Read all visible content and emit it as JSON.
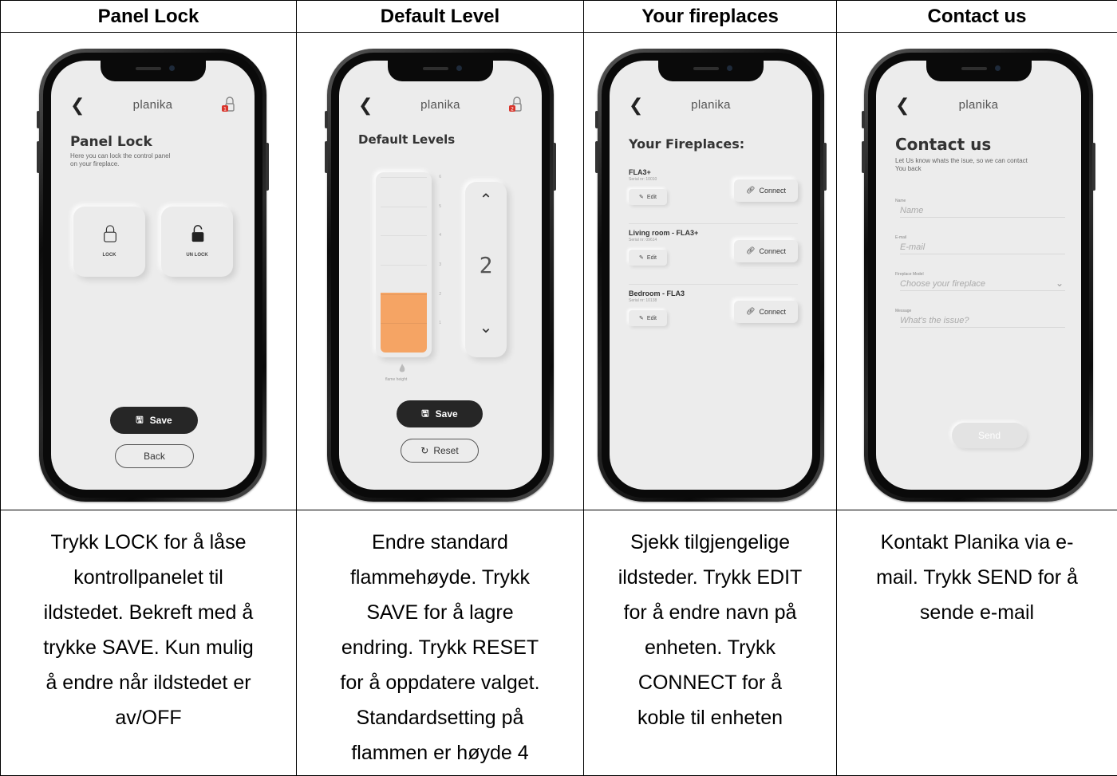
{
  "columns": [
    {
      "heading": "Panel Lock",
      "description": "Trykk LOCK for å låse\nkontrollpanelet til\nildstedet. Bekreft med å\ntrykke SAVE. Kun mulig\nå endre når ildstedet er\nav/OFF",
      "app": {
        "brand": "planika",
        "title": "Panel Lock",
        "subtitle": "Here you can lock the control panel\non your fireplace.",
        "lock_label": "LOCK",
        "unlock_label": "UN LOCK",
        "save_label": "Save",
        "back_label": "Back"
      }
    },
    {
      "heading": "Default Level",
      "description": "Endre standard\nflammehøyde. Trykk\nSAVE for å lagre\nendring. Trykk RESET\nfor å oppdatere valget.\nStandardsetting på\nflammen er høyde 4",
      "app": {
        "brand": "planika",
        "title": "Default Levels",
        "scale_ticks": [
          "6",
          "5",
          "4",
          "3",
          "2",
          "1"
        ],
        "current_level": "2",
        "level_fill_fraction": 0.34,
        "flame_caption": "flame height",
        "save_label": "Save",
        "reset_label": "Reset"
      }
    },
    {
      "heading": "Your fireplaces",
      "description": "Sjekk tilgjengelige\nildsteder. Trykk EDIT\nfor å endre navn på\nenheten. Trykk\nCONNECT for å\nkoble til enheten",
      "app": {
        "brand": "planika",
        "title": "Your Fireplaces:",
        "fireplaces": [
          {
            "name": "FLA3+",
            "serial": "Serial nr: 10010",
            "edit_label": "Edit",
            "connect_label": "Connect"
          },
          {
            "name": "Living room - FLA3+",
            "serial": "Serial nr: 09614",
            "edit_label": "Edit",
            "connect_label": "Connect"
          },
          {
            "name": "Bedroom - FLA3",
            "serial": "Serial nr: 10138",
            "edit_label": "Edit",
            "connect_label": "Connect"
          }
        ]
      }
    },
    {
      "heading": "Contact us",
      "description": "Kontakt Planika via e-\nmail. Trykk SEND for å\nsende e-mail",
      "app": {
        "brand": "planika",
        "title": "Contact us",
        "subtitle": "Let Us know whats the isue, so we can contact\nYou back",
        "fields": [
          {
            "label": "Name",
            "placeholder": "Name"
          },
          {
            "label": "E-mail",
            "placeholder": "E-mail"
          },
          {
            "label": "Fireplace Model",
            "placeholder": "Choose your fireplace"
          },
          {
            "label": "Message",
            "placeholder": "What's the issue?"
          }
        ],
        "send_label": "Send"
      }
    }
  ],
  "colors": {
    "accent_orange": "#f5a464",
    "badge_red": "#d9342b",
    "dark_button": "#262626",
    "screen_bg": "#ececec"
  }
}
